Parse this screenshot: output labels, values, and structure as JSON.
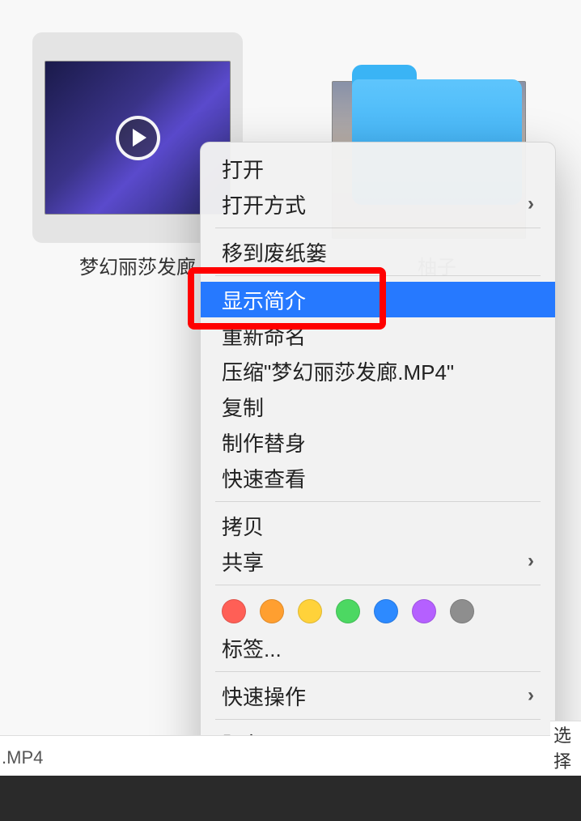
{
  "files": [
    {
      "label": "梦幻丽莎发廊",
      "kind": "video"
    },
    {
      "label": "柚子",
      "kind": "folder"
    }
  ],
  "partialFileVisible": true,
  "contextMenu": {
    "open": "打开",
    "openWith": "打开方式",
    "moveToTrash": "移到废纸篓",
    "getInfo": "显示简介",
    "rename": "重新命名",
    "compress": "压缩\"梦幻丽莎发廊.MP4\"",
    "duplicate": "复制",
    "makeAlias": "制作替身",
    "quickLook": "快速查看",
    "copy": "拷贝",
    "share": "共享",
    "tags": "标签...",
    "quickActions": "快速操作",
    "services": "服务"
  },
  "bottomBar": ".MP4",
  "rightLabel": "选择"
}
